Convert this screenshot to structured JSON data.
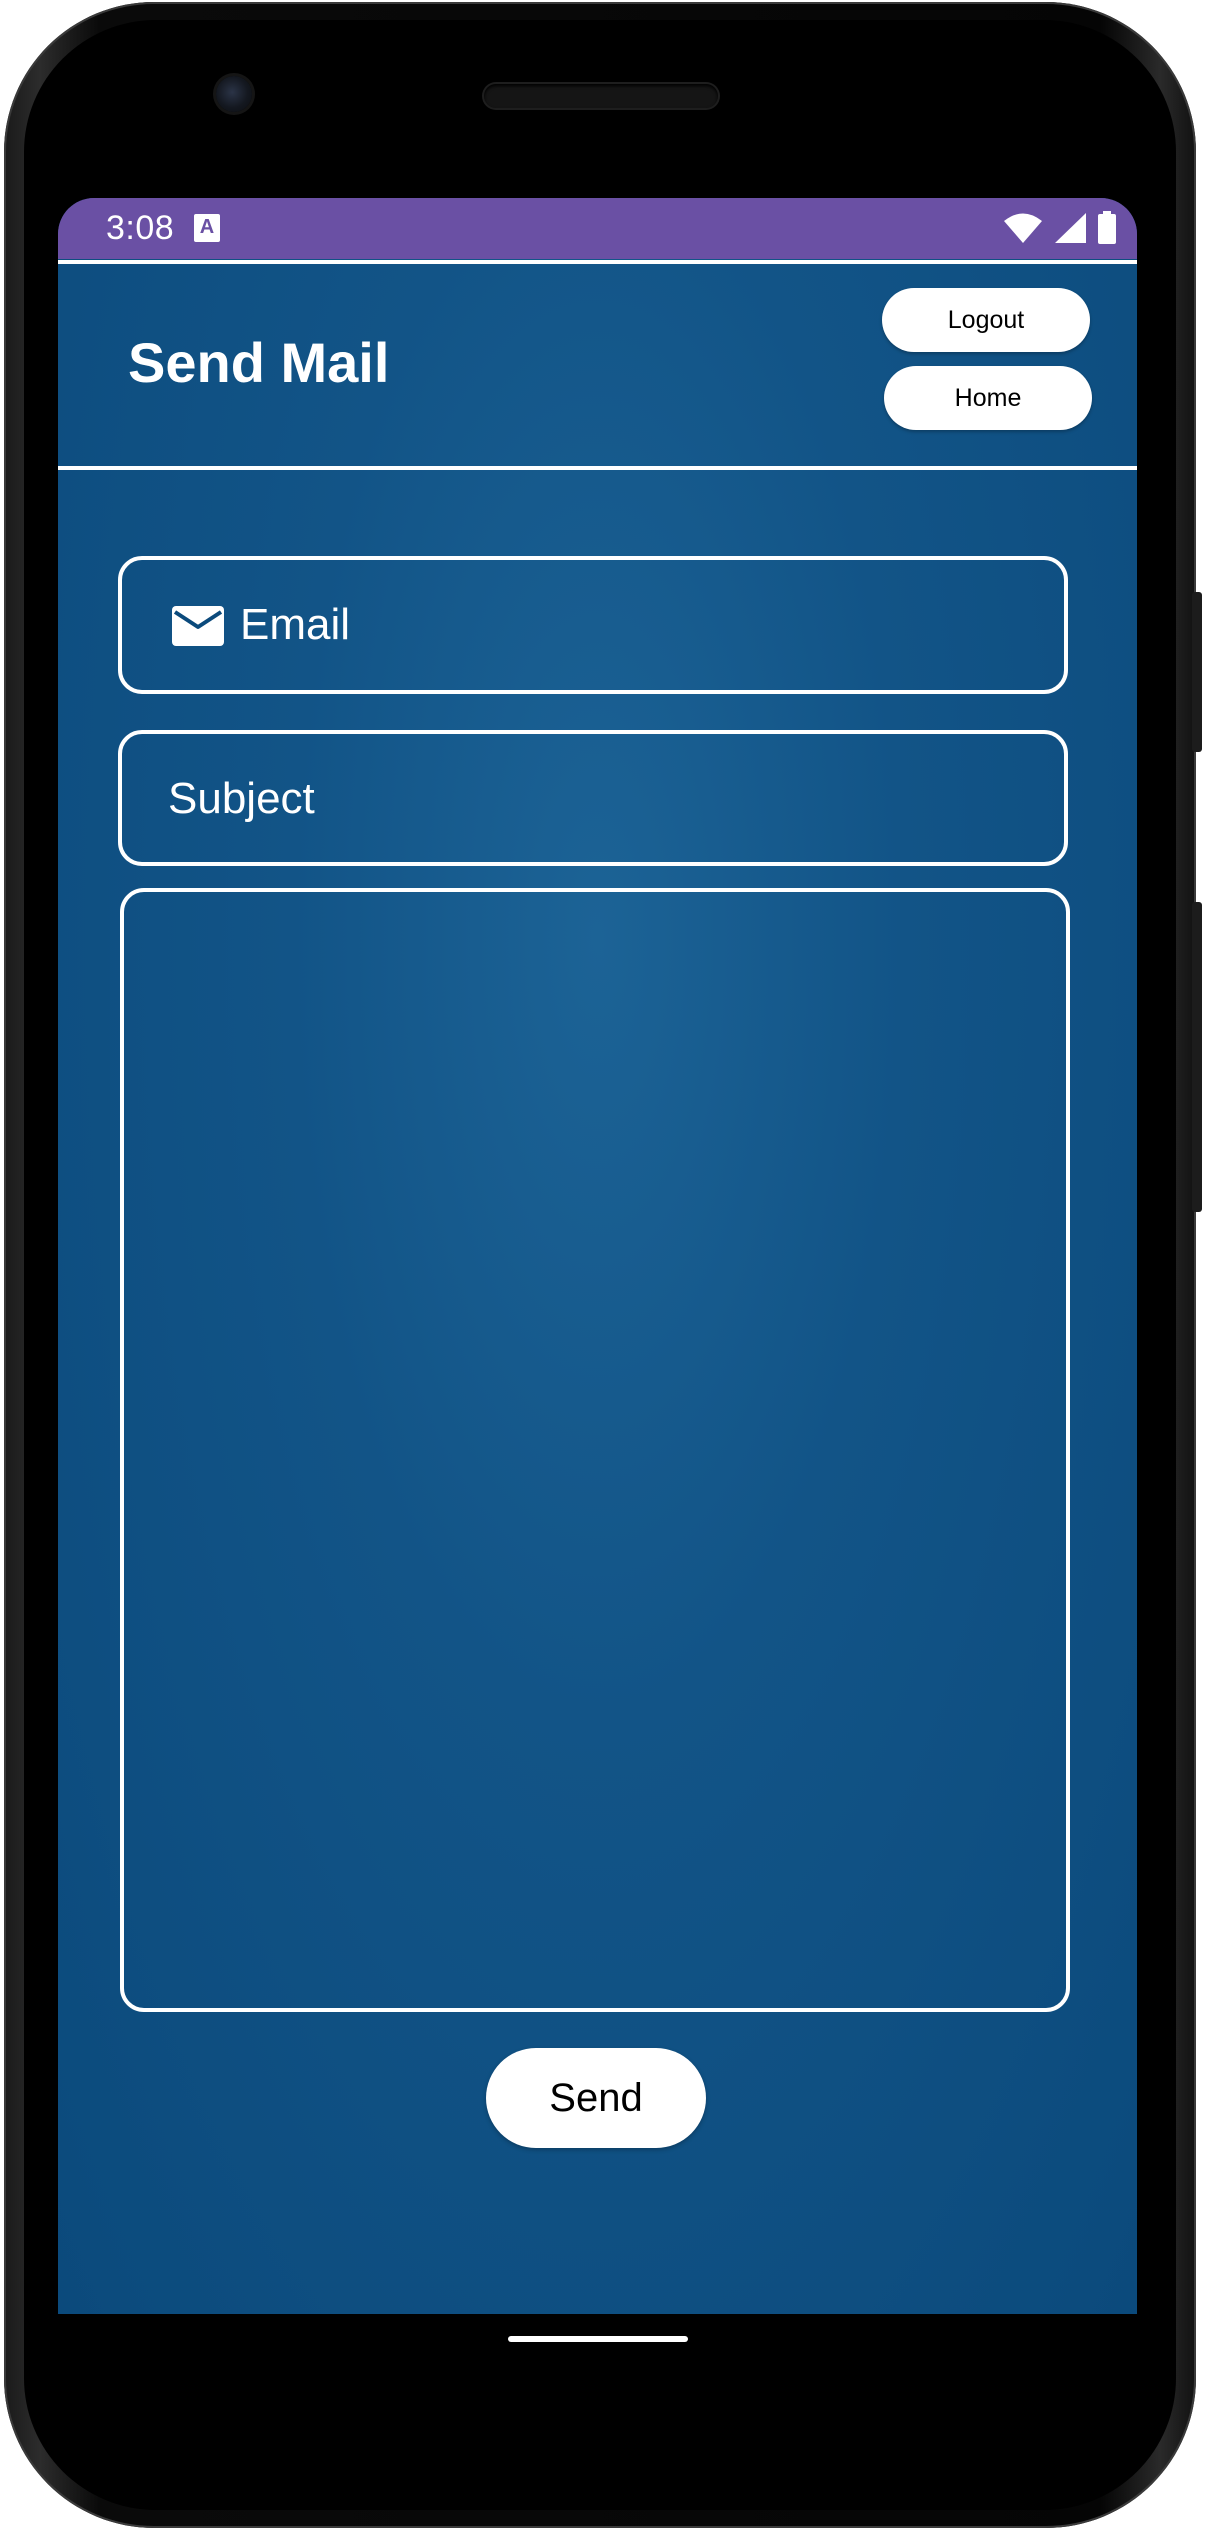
{
  "status_bar": {
    "time": "3:08",
    "keyboard_indicator": "A",
    "icons": [
      "wifi-icon",
      "signal-icon",
      "battery-icon"
    ],
    "color": "#6a50a4"
  },
  "header": {
    "title": "Send Mail",
    "logout_label": "Logout",
    "home_label": "Home"
  },
  "form": {
    "email_placeholder": "Email",
    "email_icon": "envelope-icon",
    "subject_placeholder": "Subject",
    "body_value": "",
    "send_label": "Send"
  },
  "colors": {
    "background": "#0b4a7c",
    "accent": "#ffffff"
  }
}
